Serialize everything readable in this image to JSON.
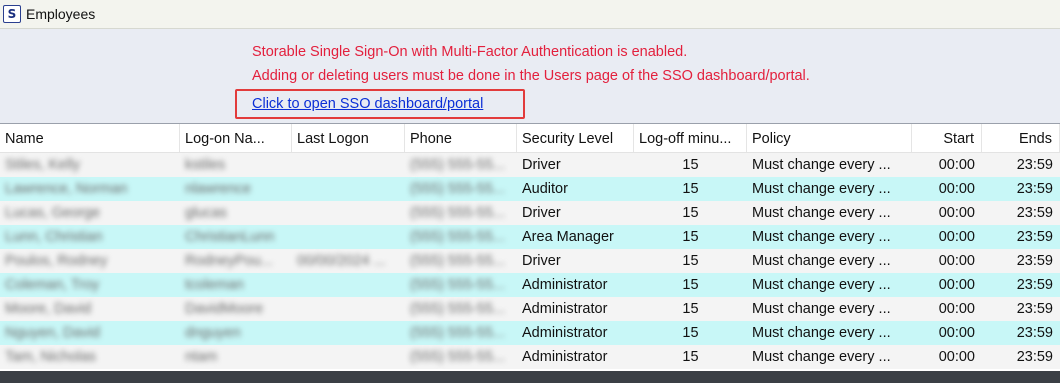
{
  "window": {
    "title": "Employees",
    "icon": "app-logo-s"
  },
  "banner": {
    "line1": "Storable Single Sign-On with Multi-Factor Authentication is enabled.",
    "line2": "Adding or deleting users must be done in the Users page of the SSO dashboard/portal.",
    "link": "Click to open SSO dashboard/portal",
    "message_color": "#e3203d",
    "link_color": "#0b2fd6",
    "highlight_color": "#e23b3b"
  },
  "columns": [
    "Name",
    "Log-on Na...",
    "Last Logon",
    "Phone",
    "Security Level",
    "Log-off minu...",
    "Policy",
    "Start",
    "Ends"
  ],
  "rows": [
    {
      "name": "Stiles, Kelly",
      "logon": "kstiles",
      "last": "",
      "phone": "(555) 555-55...",
      "level": "Driver",
      "logoff": "15",
      "policy": "Must change every ...",
      "start": "00:00",
      "ends": "23:59"
    },
    {
      "name": "Lawrence, Norman",
      "logon": "nlawrence",
      "last": "",
      "phone": "(555) 555-55...",
      "level": "Auditor",
      "logoff": "15",
      "policy": "Must change every ...",
      "start": "00:00",
      "ends": "23:59"
    },
    {
      "name": "Lucas, George",
      "logon": "glucas",
      "last": "",
      "phone": "(555) 555-55...",
      "level": "Driver",
      "logoff": "15",
      "policy": "Must change every ...",
      "start": "00:00",
      "ends": "23:59"
    },
    {
      "name": "Lunn, Christian",
      "logon": "ChristianLunn",
      "last": "",
      "phone": "(555) 555-55...",
      "level": "Area Manager",
      "logoff": "15",
      "policy": "Must change every ...",
      "start": "00:00",
      "ends": "23:59"
    },
    {
      "name": "Poulos, Rodney",
      "logon": "RodneyPou...",
      "last": "00/00/2024 ...",
      "phone": "(555) 555-55...",
      "level": "Driver",
      "logoff": "15",
      "policy": "Must change every ...",
      "start": "00:00",
      "ends": "23:59"
    },
    {
      "name": "Coleman, Troy",
      "logon": "tcoleman",
      "last": "",
      "phone": "(555) 555-55...",
      "level": "Administrator",
      "logoff": "15",
      "policy": "Must change every ...",
      "start": "00:00",
      "ends": "23:59"
    },
    {
      "name": "Moore, David",
      "logon": "DavidMoore",
      "last": "",
      "phone": "(555) 555-55...",
      "level": "Administrator",
      "logoff": "15",
      "policy": "Must change every ...",
      "start": "00:00",
      "ends": "23:59"
    },
    {
      "name": "Nguyen, David",
      "logon": "dnguyen",
      "last": "",
      "phone": "(555) 555-55...",
      "level": "Administrator",
      "logoff": "15",
      "policy": "Must change every ...",
      "start": "00:00",
      "ends": "23:59"
    },
    {
      "name": "Tam, Nicholas",
      "logon": "ntam",
      "last": "",
      "phone": "(555) 555-55...",
      "level": "Administrator",
      "logoff": "15",
      "policy": "Must change every ...",
      "start": "00:00",
      "ends": "23:59"
    }
  ],
  "row_colors": {
    "odd": "#f4f4f4",
    "even": "#c8f7f7"
  }
}
